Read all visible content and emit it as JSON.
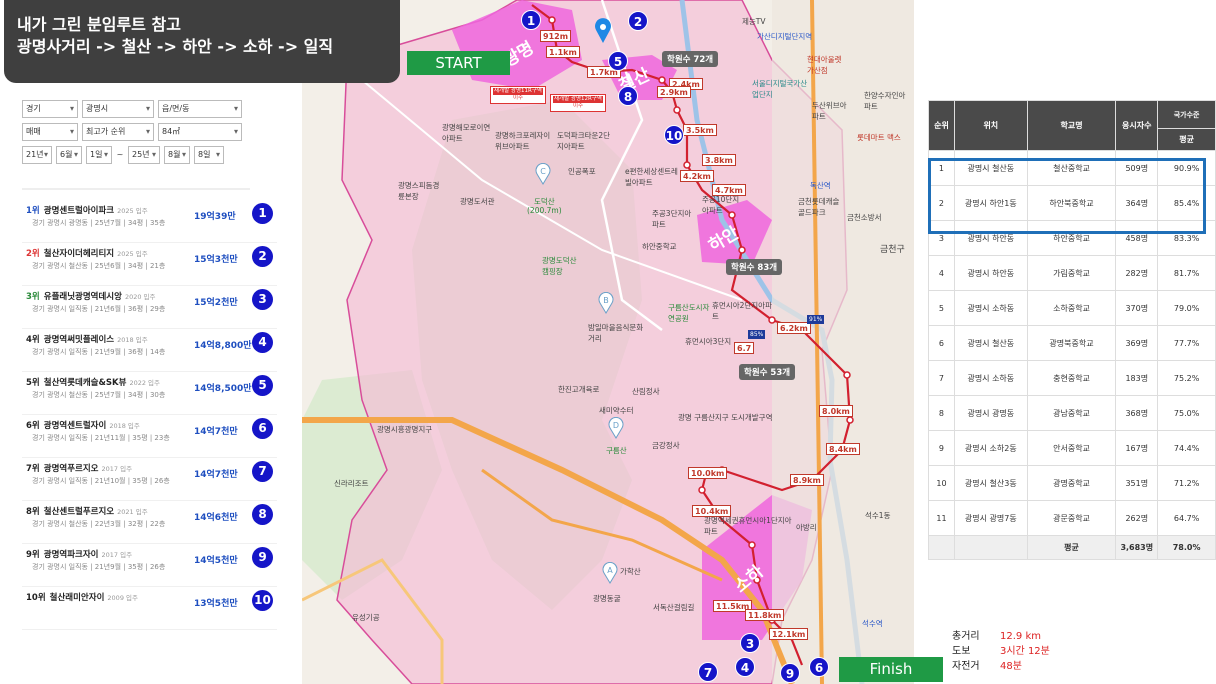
{
  "title": {
    "line1": "내가 그린 분임루트 참고",
    "line2": "광명사거리 -> 철산 -> 하안 -> 소하 -> 일직"
  },
  "start_label": "START",
  "finish_label": "Finish",
  "filters": {
    "row1": [
      "경기",
      "광명시",
      "읍/면/동"
    ],
    "row2": [
      "매매",
      "최고가 순위",
      "84㎡"
    ],
    "row3": [
      "21년",
      "6월",
      "1일",
      "~",
      "25년",
      "8월",
      "8일"
    ]
  },
  "rank_list": [
    {
      "rank": "1위",
      "name": "광명센트럴아이파크",
      "year": "2025 입주",
      "info": "경기 광명시 광명동 | 25년7월 | 34평 | 35층",
      "price": "19억39만",
      "num": "1",
      "rank_color": "#1f4fc0"
    },
    {
      "rank": "2위",
      "name": "철산자이더헤리티지",
      "year": "2025 입주",
      "info": "경기 광명시 철산동 | 25년6월 | 34평 | 21층",
      "price": "15억3천만",
      "num": "2",
      "rank_color": "#d33"
    },
    {
      "rank": "3위",
      "name": "유플래닛광명역데시앙",
      "year": "2020 입주",
      "info": "경기 광명시 일직동 | 21년6월 | 36평 | 29층",
      "price": "15억2천만",
      "num": "3",
      "rank_color": "#2a8a3a"
    },
    {
      "rank": "4위",
      "name": "광명역써밋플레이스",
      "year": "2018 입주",
      "info": "경기 광명시 일직동 | 21년9월 | 36평 | 14층",
      "price": "14억8,800만",
      "num": "4",
      "rank_color": "#222"
    },
    {
      "rank": "5위",
      "name": "철산역롯데캐슬&SK뷰",
      "year": "2022 입주",
      "info": "경기 광명시 철산동 | 25년7월 | 34평 | 30층",
      "price": "14억8,500만",
      "num": "5",
      "rank_color": "#222"
    },
    {
      "rank": "6위",
      "name": "광명역센트럴자이",
      "year": "2018 입주",
      "info": "경기 광명시 일직동 | 21년11월 | 35평 | 23층",
      "price": "14억7천만",
      "num": "6",
      "rank_color": "#222"
    },
    {
      "rank": "7위",
      "name": "광명역푸르지오",
      "year": "2017 입주",
      "info": "경기 광명시 일직동 | 21년10월 | 35평 | 26층",
      "price": "14억7천만",
      "num": "7",
      "rank_color": "#222"
    },
    {
      "rank": "8위",
      "name": "철산센트럴푸르지오",
      "year": "2021 입주",
      "info": "경기 광명시 철산동 | 22년3월 | 32평 | 22층",
      "price": "14억6천만",
      "num": "8",
      "rank_color": "#222"
    },
    {
      "rank": "9위",
      "name": "광명역파크자이",
      "year": "2017 입주",
      "info": "경기 광명시 일직동 | 21년9월 | 35평 | 26층",
      "price": "14억5천만",
      "num": "9",
      "rank_color": "#222"
    },
    {
      "rank": "10위",
      "name": "철산래미안자이",
      "year": "2009 입주",
      "info": "",
      "price": "13억5천만",
      "num": "10",
      "rank_color": "#222"
    }
  ],
  "map": {
    "km_labels": [
      "912m",
      "1.1km",
      "1.7km",
      "2.4km",
      "2.9km",
      "3.5km",
      "3.8km",
      "4.2km",
      "4.7km",
      "6.2km",
      "6.7",
      "8.0km",
      "8.4km",
      "8.9km",
      "10.0km",
      "10.4km",
      "11.5km",
      "11.8km",
      "12.1km"
    ],
    "hak": [
      "학원수 72개",
      "학원수 83개",
      "학원수 53개"
    ],
    "districts": [
      "광명",
      "철산",
      "하안",
      "소하"
    ],
    "redevelop": [
      {
        "top": "재개발 광명11R구역",
        "bottom": "이주"
      },
      {
        "top": "재개발 광명12R구역",
        "bottom": "이주"
      }
    ],
    "places": [
      "제능TV",
      "가산디지털단지역",
      "서울디지털국가산업단지",
      "현대아울렛가산점",
      "한양수자인아파트",
      "두산위브아파트",
      "롯데마트 맥스",
      "광명해모로이연아파트",
      "광명하크포레자이위브아파트",
      "도덕파크타운2단지아파트",
      "인공폭포",
      "e편한세상센트레빌아파트",
      "주공3단지아파트",
      "주공10단지아파트",
      "광명스피돔경륜본장",
      "광명도서관",
      "도덕산",
      "(200.7m)",
      "광명도덕산캠핑장",
      "밤일마을음식문화거리",
      "구름산도시자연공원",
      "휴먼시아2단지아파트",
      "휴먼시아3단지",
      "한진고개육로",
      "산림정사",
      "새미약수터",
      "구름산",
      "금강정사",
      "광명시흥광명지구",
      "광명역세권휴먼시아1단지아파트",
      "가학산",
      "광명동굴",
      "서독산걸림길",
      "유성기공",
      "신라리조트",
      "금천구",
      "금천소방서",
      "독산역",
      "금천롯데캐슬골드파크",
      "하안중학교",
      "광명 구름산지구 도시개발구역",
      "석수1동",
      "아방리",
      "석수역",
      "91%",
      "85%"
    ],
    "route_numbers": [
      "1",
      "2",
      "3",
      "4",
      "5",
      "6",
      "7",
      "8",
      "9",
      "10"
    ]
  },
  "school_table": {
    "headers": [
      "순위",
      "위치",
      "학교명",
      "응시자수",
      "국가수준",
      "평균"
    ],
    "rows": [
      [
        "1",
        "광명시 철산동",
        "철산중학교",
        "509명",
        "90.9%"
      ],
      [
        "2",
        "광명시 하안1동",
        "하안북중학교",
        "364명",
        "85.4%"
      ],
      [
        "3",
        "광명시 하안동",
        "하안중학교",
        "458명",
        "83.3%"
      ],
      [
        "4",
        "광명시 하안동",
        "가림중학교",
        "282명",
        "81.7%"
      ],
      [
        "5",
        "광명시 소하동",
        "소하중학교",
        "370명",
        "79.0%"
      ],
      [
        "6",
        "광명시 철산동",
        "광명북중학교",
        "369명",
        "77.7%"
      ],
      [
        "7",
        "광명시 소하동",
        "충현중학교",
        "183명",
        "75.2%"
      ],
      [
        "8",
        "광명시 광명동",
        "광남중학교",
        "368명",
        "75.0%"
      ],
      [
        "9",
        "광명시 소하2동",
        "안서중학교",
        "167명",
        "74.4%"
      ],
      [
        "10",
        "광명시 철산3동",
        "광명중학교",
        "351명",
        "71.2%"
      ],
      [
        "11",
        "광명시 광명7동",
        "광문중학교",
        "262명",
        "64.7%"
      ]
    ],
    "summary": {
      "label": "평균",
      "count": "3,683명",
      "pct": "78.0%"
    }
  },
  "stats": [
    {
      "label": "총거리",
      "value": "12.9 km"
    },
    {
      "label": "도보",
      "value": "3시간 12분"
    },
    {
      "label": "자전거",
      "value": "48분"
    }
  ],
  "colors": {
    "route": "#d2202f",
    "circle": "#1515c8",
    "start": "#1f9a45",
    "highlight": "#1f6fb8"
  }
}
